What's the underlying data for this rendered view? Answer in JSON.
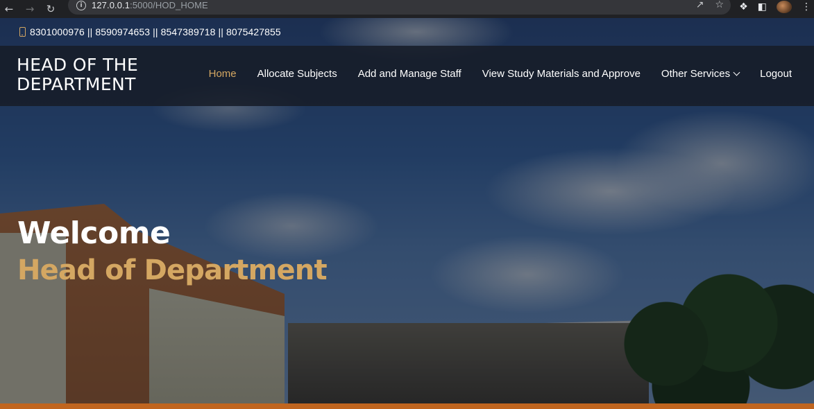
{
  "browser": {
    "url_host": "127.0.0.1",
    "url_rest": ":5000/HOD_HOME",
    "icons": [
      "back-arrow-icon",
      "forward-arrow-icon",
      "reload-icon",
      "info-icon",
      "share-icon",
      "star-icon",
      "puzzle-icon",
      "sidepanel-icon",
      "avatar",
      "kebab-menu-icon"
    ]
  },
  "topbar": {
    "phones": "8301000976 || 8590974653 || 8547389718 || 8075427855",
    "icon": "phone-icon"
  },
  "navbar": {
    "brand_line1": "HEAD OF THE",
    "brand_line2": "DEPARTMENT",
    "items": [
      {
        "label": "Home",
        "active": true
      },
      {
        "label": "Allocate Subjects"
      },
      {
        "label": "Add and Manage Staff"
      },
      {
        "label": "View Study Materials and Approve"
      },
      {
        "label": "Other Services",
        "dropdown": true
      },
      {
        "label": "Logout"
      }
    ]
  },
  "hero": {
    "welcome": "Welcome",
    "role": "Head of Department"
  },
  "colors": {
    "accent": "#d4a762",
    "navbar_bg": "#171c28",
    "bottom_bar": "#c0651f"
  }
}
